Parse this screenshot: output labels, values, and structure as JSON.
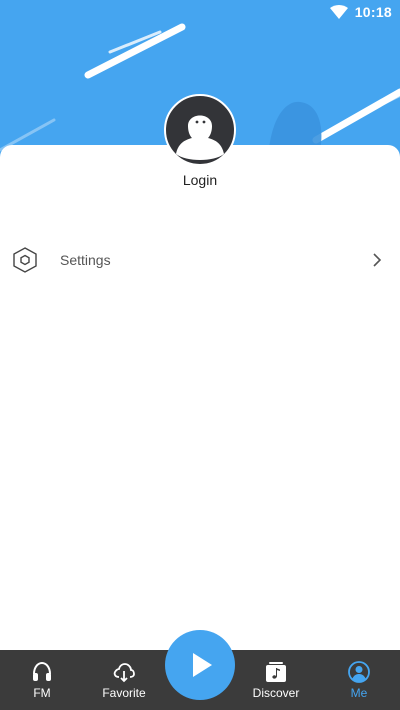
{
  "status_bar": {
    "time": "10:18",
    "icons": [
      "wifi-icon"
    ]
  },
  "profile": {
    "login_label": "Login",
    "avatar_icon": "ghost-avatar-icon"
  },
  "menu": {
    "items": [
      {
        "label": "Settings",
        "icon": "settings-icon",
        "trailing_icon": "chevron-right-icon"
      }
    ]
  },
  "bottom_nav": {
    "items": [
      {
        "label": "FM",
        "icon": "headphones-icon",
        "active": false
      },
      {
        "label": "Favorite",
        "icon": "cloud-download-icon",
        "active": false
      },
      {
        "label": "Discover",
        "icon": "music-note-icon",
        "active": false
      },
      {
        "label": "Me",
        "icon": "user-icon",
        "active": true
      }
    ],
    "center_button": {
      "icon": "play-icon"
    }
  },
  "colors": {
    "accent": "#45a5f0",
    "nav_background": "#3b3b3b",
    "avatar_background": "#333438",
    "active_nav": "#45a5f0"
  }
}
